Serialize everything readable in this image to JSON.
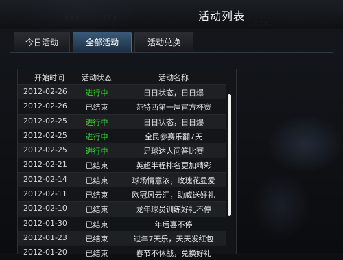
{
  "window": {
    "title": "活动列表"
  },
  "tabs": [
    {
      "label": "今日活动",
      "active": false
    },
    {
      "label": "全部活动",
      "active": true
    },
    {
      "label": "活动兑换",
      "active": false
    }
  ],
  "table": {
    "headers": [
      "开始时间",
      "活动状态",
      "活动名称"
    ],
    "rows": [
      {
        "date": "2012-02-26",
        "status": "进行中",
        "name": "日日状态，日日爆"
      },
      {
        "date": "2012-02-26",
        "status": "已结束",
        "name": "范特西第一届官方杯赛"
      },
      {
        "date": "2012-02-25",
        "status": "进行中",
        "name": "日日状态，日日爆"
      },
      {
        "date": "2012-02-25",
        "status": "进行中",
        "name": "全民参赛乐翻7天"
      },
      {
        "date": "2012-02-25",
        "status": "进行中",
        "name": "足球达人问答比赛"
      },
      {
        "date": "2012-02-21",
        "status": "已结束",
        "name": "英超半程排名更加精彩"
      },
      {
        "date": "2012-02-14",
        "status": "已结束",
        "name": "球场情意浓，玫瑰花显爱"
      },
      {
        "date": "2012-02-11",
        "status": "已结束",
        "name": "欧冠风云汇，助威送好礼"
      },
      {
        "date": "2012-02-10",
        "status": "已结束",
        "name": "龙年球员训练好礼不停"
      },
      {
        "date": "2012-01-30",
        "status": "已结束",
        "name": "年后喜不停"
      },
      {
        "date": "2012-01-23",
        "status": "已结束",
        "name": "过年7天乐，天天发红包"
      },
      {
        "date": "2012-01-20",
        "status": "已结束",
        "name": "春节不休战，兑换好礼"
      }
    ]
  },
  "colors": {
    "status_active": "#38e038",
    "status_ended": "#d8d8d8",
    "tab_active": "#2c4a66"
  }
}
